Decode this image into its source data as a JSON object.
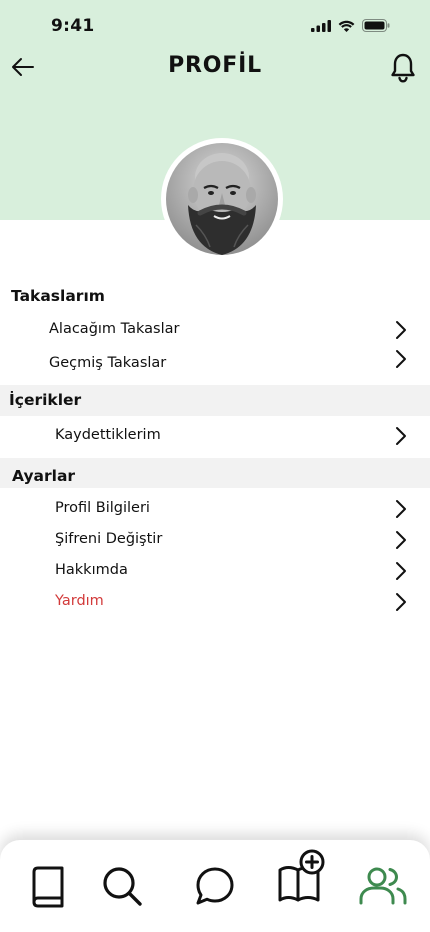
{
  "status_bar": {
    "time": "9:41"
  },
  "header": {
    "title": "PROFİL"
  },
  "sections": {
    "takaslarim": {
      "title": "Takaslarım",
      "items": [
        "Alacağım Takaslar",
        "Geçmiş Takaslar"
      ]
    },
    "icerikler": {
      "title": "İçerikler",
      "items": [
        "Kaydettiklerim"
      ]
    },
    "ayarlar": {
      "title": "Ayarlar",
      "items": [
        "Profil Bilgileri",
        "Şifreni Değiştir",
        "Hakkımda",
        "Yardım"
      ]
    }
  },
  "colors": {
    "header_bg": "#d8efdc",
    "accent_green": "#3e8a4f",
    "help_red": "#d23a3a",
    "section_gray": "#f2f2f2"
  },
  "bottom_nav": {
    "items": [
      "book-icon",
      "search-icon",
      "chat-icon",
      "add-book-icon",
      "users-icon"
    ],
    "active": "users-icon"
  }
}
